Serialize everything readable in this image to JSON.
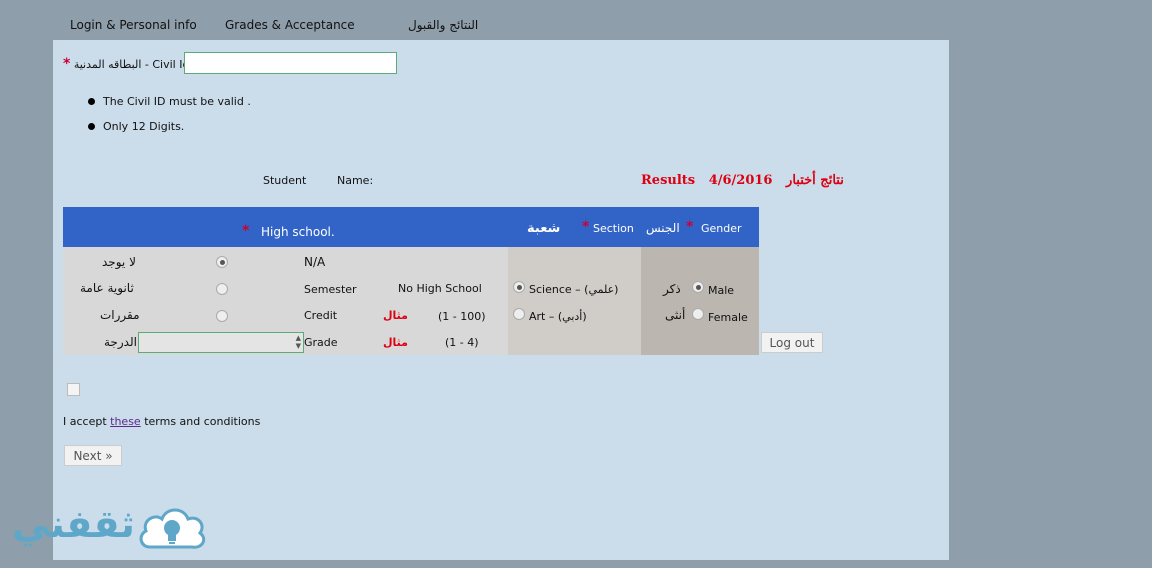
{
  "tabs": {
    "login": "Login & Personal info",
    "grades": "Grades & Acceptance",
    "results": "النتائج والقبول"
  },
  "civil": {
    "label": "البطاقه المدنية - Civil Id",
    "value": "",
    "rules": [
      "The Civil ID must be valid .",
      "Only 12 Digits."
    ]
  },
  "student": {
    "student_label": "Student",
    "name_label": "Name:"
  },
  "results_heading": {
    "ar": "نتائج أختبار",
    "date": "4/6/2016",
    "en": "Results"
  },
  "table": {
    "header": {
      "high_school": "High school.",
      "shoba": "شعبة",
      "section": "Section",
      "gender_ar": "الجنس",
      "gender_en": "Gender"
    },
    "options": {
      "none_ar": "لا يوجد",
      "none_en": "N/A",
      "secondary_ar": "ثانوية عامة",
      "semester": "Semester",
      "no_high_school": "No High School",
      "courses_ar": "مقررات",
      "credit": "Credit",
      "example_ar": "مثال",
      "credit_range": "(1 - 100)",
      "degree_ar": "الدرجة",
      "grade": "Grade",
      "grade_range": "(1 - 4)"
    },
    "sections": {
      "science": "Science – (علمي)",
      "art": "Art – (أدبي)"
    },
    "gender": {
      "male_ar": "ذكر",
      "male_en": "Male",
      "female_ar": "أنثى",
      "female_en": "Female"
    }
  },
  "buttons": {
    "logout": "Log out",
    "next": "Next »"
  },
  "terms": {
    "prefix": "I accept ",
    "link": "these",
    "suffix": " terms and conditions"
  },
  "brand": {
    "logo_text": "ثقفني",
    "accent": "#5ea7c9"
  },
  "colors": {
    "header_bg": "#3264c8",
    "panel_bg": "#cbdceb",
    "required": "#cc0033"
  }
}
